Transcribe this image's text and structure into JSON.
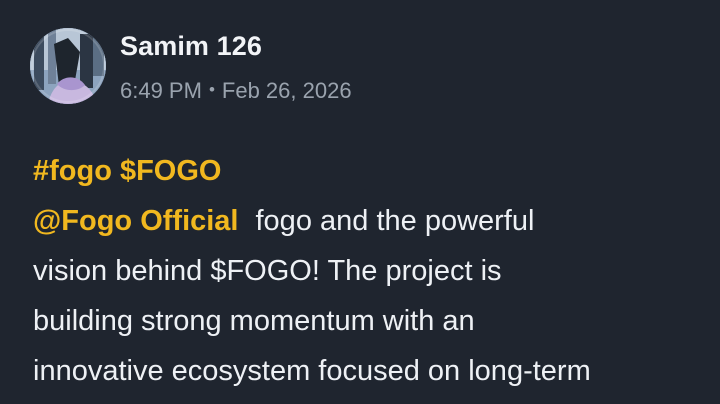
{
  "post": {
    "author": "Samim 126",
    "time": "6:49 PM",
    "separator": "•",
    "date": "Feb 26, 2026",
    "hashtags": [
      "#fogo",
      "$FOGO"
    ],
    "mention": "@Fogo Official",
    "body_lines": [
      "fogo and the powerful",
      "vision behind $FOGO! The project is",
      "building strong momentum with an",
      "innovative ecosystem focused on long-term"
    ]
  },
  "colors": {
    "background": "#1f252f",
    "text": "#eef1f5",
    "secondary_text": "#9aa3ae",
    "accent": "#f1b81f"
  }
}
